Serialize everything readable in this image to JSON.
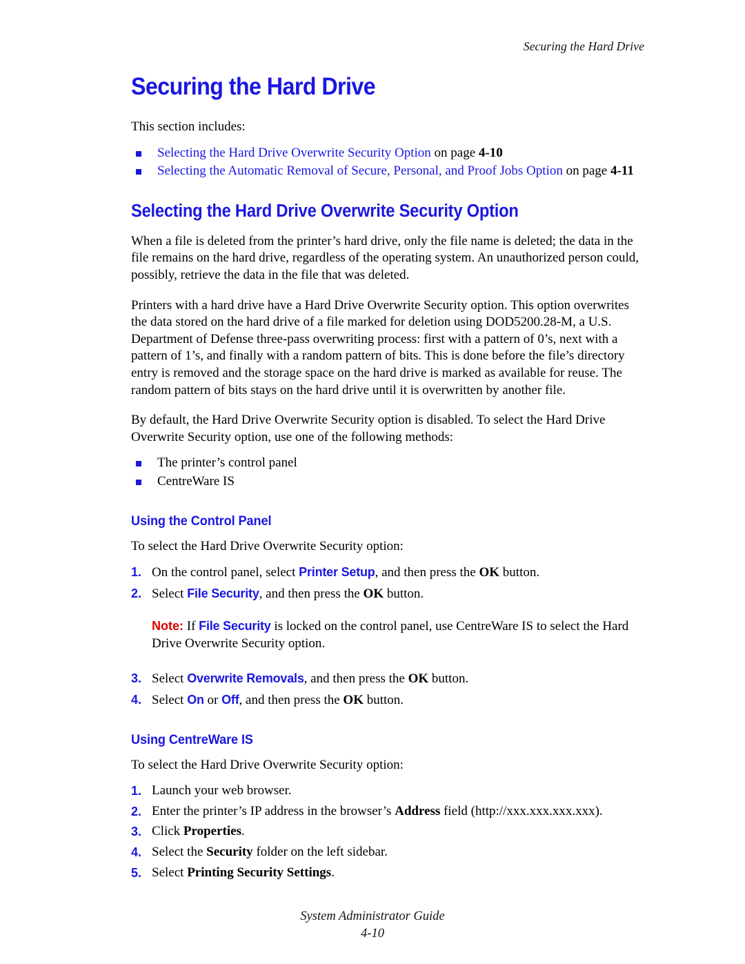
{
  "header": {
    "running_head": "Securing the Hard Drive"
  },
  "chapter": {
    "title": "Securing the Hard Drive",
    "intro": "This section includes:",
    "toc": [
      {
        "link": "Selecting the Hard Drive Overwrite Security Option",
        "suffix": " on page ",
        "page": "4-10"
      },
      {
        "link": "Selecting the Automatic Removal of Secure, Personal, and Proof Jobs Option",
        "suffix": " on page ",
        "page": "4-11"
      }
    ]
  },
  "section": {
    "title": "Selecting the Hard Drive Overwrite Security Option",
    "para1": "When a file is deleted from the printer’s hard drive, only the file name is deleted; the data in the file remains on the hard drive, regardless of the operating system. An unauthorized person could, possibly, retrieve the data in the file that was deleted.",
    "para2": "Printers with a hard drive have a Hard Drive Overwrite Security option. This option overwrites the data stored on the hard drive of a file marked for deletion using DOD5200.28-M, a U.S. Department of Defense three-pass overwriting process: first with a pattern of 0’s, next with a pattern of 1’s, and finally with a random pattern of bits. This is done before the file’s directory entry is removed and the storage space on the hard drive is marked as available for reuse. The random pattern of bits stays on the hard drive until it is overwritten by another file.",
    "para3": "By default, the Hard Drive Overwrite Security option is disabled. To select the Hard Drive Overwrite Security option, use one of the following methods:",
    "methods": [
      "The printer’s control panel",
      "CentreWare IS"
    ]
  },
  "control_panel": {
    "title": "Using the Control Panel",
    "lead": "To select the Hard Drive Overwrite Security option:",
    "step1": {
      "num": "1.",
      "pre": "On the control panel, select ",
      "ui": "Printer Setup",
      "mid": ", and then press the ",
      "key": "OK",
      "post": " button."
    },
    "step2": {
      "num": "2.",
      "pre": "Select ",
      "ui": "File Security",
      "mid": ", and then press the ",
      "key": "OK",
      "post": " button."
    },
    "note": {
      "label": "Note:",
      "pre": " If ",
      "ui": "File Security",
      "post": " is locked on the control panel, use CentreWare IS to select the Hard Drive Overwrite Security option."
    },
    "step3": {
      "num": "3.",
      "pre": "Select ",
      "ui": "Overwrite Removals",
      "mid": ", and then press the ",
      "key": "OK",
      "post": " button."
    },
    "step4": {
      "num": "4.",
      "pre": "Select ",
      "ui_on": "On",
      "or": " or ",
      "ui_off": "Off",
      "mid": ", and then press the ",
      "key": "OK",
      "post": " button."
    }
  },
  "centreware": {
    "title": "Using CentreWare IS",
    "lead": "To select the Hard Drive Overwrite Security option:",
    "step1": {
      "num": "1.",
      "text": "Launch your web browser."
    },
    "step2": {
      "num": "2.",
      "pre": "Enter the printer’s IP address in the browser’s ",
      "bold": "Address",
      "post": " field (http://xxx.xxx.xxx.xxx)."
    },
    "step3": {
      "num": "3.",
      "pre": "Click ",
      "bold": "Properties",
      "post": "."
    },
    "step4": {
      "num": "4.",
      "pre": "Select the ",
      "bold": "Security",
      "post": " folder on the left sidebar."
    },
    "step5": {
      "num": "5.",
      "pre": "Select ",
      "bold": "Printing Security Settings",
      "post": "."
    }
  },
  "footer": {
    "guide": "System Administrator Guide",
    "page": "4-10"
  },
  "colors": {
    "accent_blue": "#1a17e0",
    "note_red": "#e00000",
    "text": "#000000"
  }
}
